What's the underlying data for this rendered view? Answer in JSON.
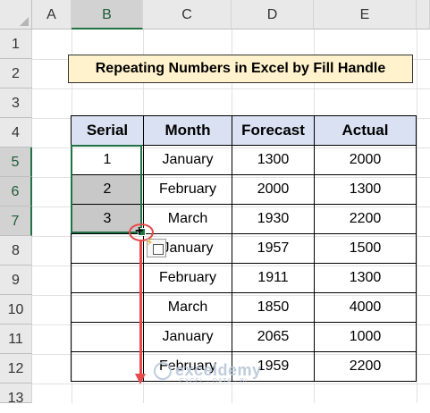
{
  "columns": [
    "A",
    "B",
    "C",
    "D",
    "E"
  ],
  "rows": [
    "1",
    "2",
    "3",
    "4",
    "5",
    "6",
    "7",
    "8",
    "9",
    "10",
    "11",
    "12",
    "13"
  ],
  "title": "Repeating Numbers in Excel by Fill Handle",
  "table": {
    "headers": [
      "Serial",
      "Month",
      "Forecast",
      "Actual"
    ],
    "rows": [
      [
        "1",
        "January",
        "1300",
        "2000"
      ],
      [
        "2",
        "February",
        "2000",
        "1300"
      ],
      [
        "3",
        "March",
        "1930",
        "2200"
      ],
      [
        "",
        "January",
        "1957",
        "1500"
      ],
      [
        "",
        "February",
        "1911",
        "1300"
      ],
      [
        "",
        "March",
        "1850",
        "4000"
      ],
      [
        "",
        "January",
        "2065",
        "1000"
      ],
      [
        "",
        "February",
        "1959",
        "2200"
      ]
    ]
  },
  "cursor_glyph": "+",
  "autofill_icon": "auto-fill-options-icon",
  "watermark": {
    "name": "exceldemy",
    "tagline": "EXCEL · DATA · BI"
  },
  "colors": {
    "selection": "#217346",
    "header_fill": "#d9e1f2",
    "title_fill": "#fff2cc",
    "annotation": "#e64a4a"
  }
}
